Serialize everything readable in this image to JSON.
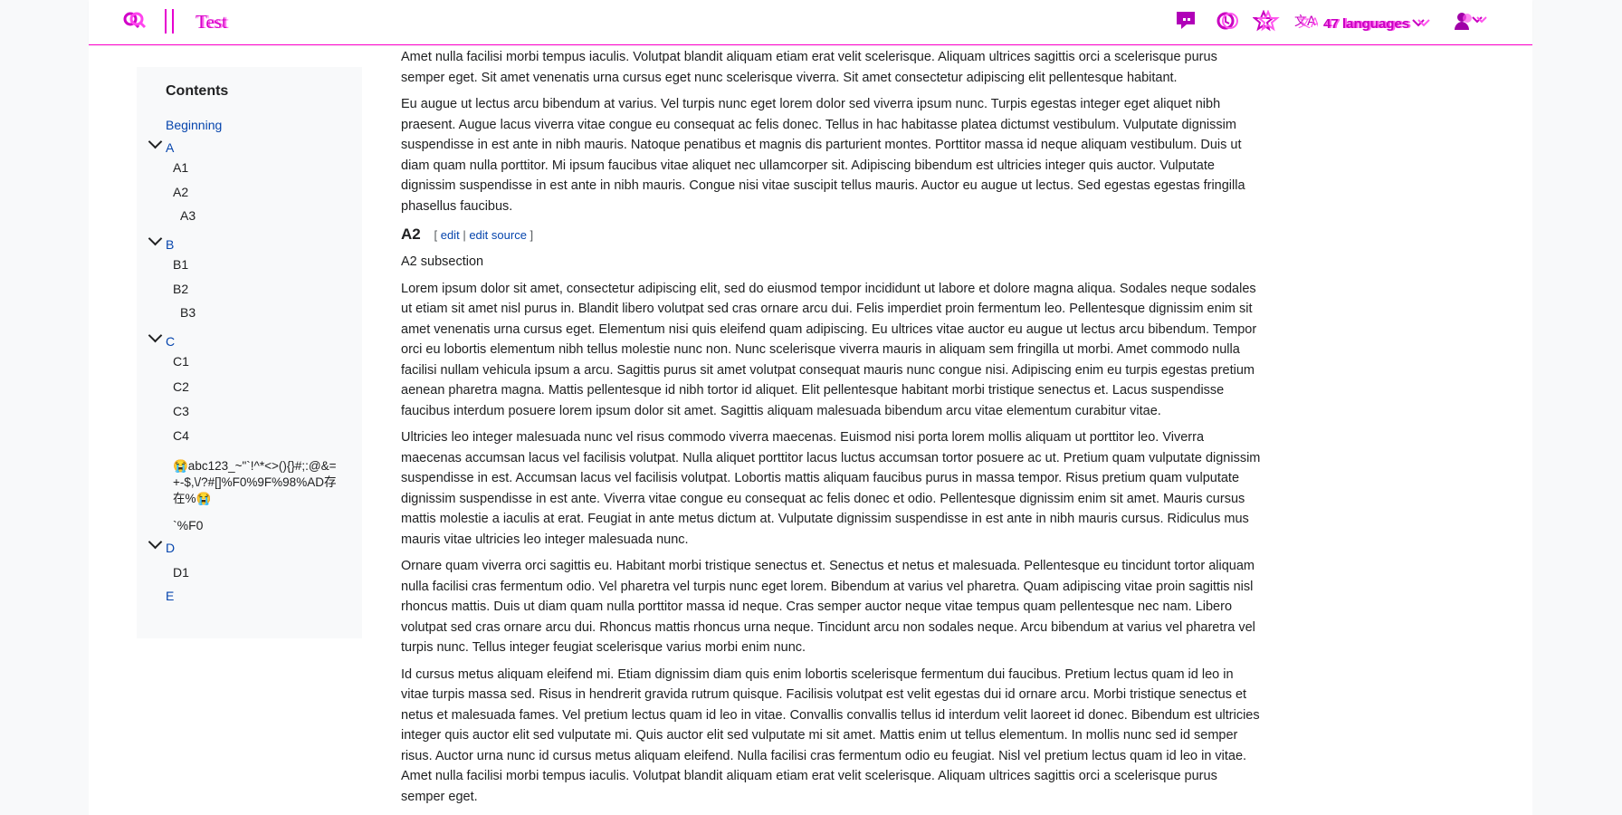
{
  "header": {
    "search_icon": "search-icon",
    "title": "Test",
    "languages_label": "47 languages",
    "icons": [
      "talk-icon",
      "history-icon",
      "watch-star-icon",
      "language-icon",
      "user-icon"
    ]
  },
  "toc": {
    "heading": "Contents",
    "items": [
      {
        "label": "Beginning"
      },
      {
        "label": "A"
      },
      {
        "label": "A1"
      },
      {
        "label": "A2"
      },
      {
        "label": "A3"
      },
      {
        "label": "B"
      },
      {
        "label": "B1"
      },
      {
        "label": "B2"
      },
      {
        "label": "B3"
      },
      {
        "label": "C"
      },
      {
        "label": "C1"
      },
      {
        "label": "C2"
      },
      {
        "label": "C3"
      },
      {
        "label": "C4"
      },
      {
        "label": "😭abc123_~\"`!^*<>(){}#;:@&=+-$,\\/?#[]%F0%9F%98%AD存在%😭"
      },
      {
        "label": "`%F0"
      },
      {
        "label": "D"
      },
      {
        "label": "D1"
      },
      {
        "label": "E"
      }
    ]
  },
  "article": {
    "p0": "turpis massa sed. Risus in hendrerit gravida rutrum quisque. Facilisis volutpat est velit egestas dui id ornare arcu. Morbi tristique senectus et netus et malesuada fames. Vel pretium lectus quam id leo in vitae. Convallis convallis tellus id interdum velit laoreet id donec. Bibendum est ultricies integer quis auctor elit sed vulputate mi. Quis auctor elit sed vulputate mi sit amet. Mattis enim ut tellus elementum. In mollis nunc sed id semper risus. Auctor urna nunc id cursus metus aliquam eleifend. Nulla facilisi cras fermentum odio eu feugiat. Nisl vel pretium lectus quam id leo in vitae. Amet nulla facilisi morbi tempus iaculis. Volutpat blandit aliquam etiam erat velit scelerisque. Aliquam ultrices sagittis orci a scelerisque purus semper eget. Sit amet venenatis urna cursus eget nunc scelerisque viverra. Sit amet consectetur adipiscing elit pellentesque habitant.",
    "p1": "Eu augue ut lectus arcu bibendum at varius. Vel turpis nunc eget lorem dolor sed viverra ipsum nunc. Turpis egestas integer eget aliquet nibh praesent. Augue lacus viverra vitae congue eu consequat ac felis donec. Tellus in hac habitasse platea dictumst vestibulum. Vulputate dignissim suspendisse in est ante in nibh mauris. Natoque penatibus et magnis dis parturient montes. Porttitor massa id neque aliquam vestibulum. Duis ut diam quam nulla porttitor. Mi ipsum faucibus vitae aliquet nec ullamcorper sit. Adipiscing bibendum est ultricies integer quis auctor. Vulputate dignissim suspendisse in est ante in nibh mauris. Congue nisi vitae suscipit tellus mauris. Auctor eu augue ut lectus. Sed egestas egestas fringilla phasellus faucibus.",
    "h_a2": "A2",
    "edit_open": "[",
    "edit": "edit",
    "edit_sep": "|",
    "edit_source": "edit source",
    "edit_close": "]",
    "a2_sub": "A2 subsection",
    "p2": "Lorem ipsum dolor sit amet, consectetur adipiscing elit, sed do eiusmod tempor incididunt ut labore et dolore magna aliqua. Sodales neque sodales ut etiam sit amet nisl purus in. Blandit libero volutpat sed cras ornare arcu dui. Felis imperdiet proin fermentum leo. Pellentesque dignissim enim sit amet venenatis urna cursus eget. Elementum nisi quis eleifend quam adipiscing. Eu ultrices vitae auctor eu augue ut lectus arcu bibendum. Tempor orci eu lobortis elementum nibh tellus molestie nunc non. Nunc scelerisque viverra mauris in aliquam sem fringilla ut morbi. Amet commodo nulla facilisi nullam vehicula ipsum a arcu. Sagittis purus sit amet volutpat consequat mauris nunc congue nisi. Adipiscing enim eu turpis egestas pretium aenean pharetra magna. Mattis pellentesque id nibh tortor id aliquet. Elit pellentesque habitant morbi tristique senectus et. Lacus suspendisse faucibus interdum posuere lorem ipsum dolor sit amet. Sagittis aliquam malesuada bibendum arcu vitae elementum curabitur vitae.",
    "p3": "Ultricies leo integer malesuada nunc vel risus commodo viverra maecenas. Euismod nisi porta lorem mollis aliquam ut porttitor leo. Viverra maecenas accumsan lacus vel facilisis volutpat. Nulla aliquet porttitor lacus luctus accumsan tortor posuere ac ut. Pretium quam vulputate dignissim suspendisse in est. Accumsan lacus vel facilisis volutpat. Lobortis mattis aliquam faucibus purus in massa tempor. Risus pretium quam vulputate dignissim suspendisse in est ante. Viverra vitae congue eu consequat ac felis donec et odio. Pellentesque dignissim enim sit amet. Mauris cursus mattis molestie a iaculis at erat. Feugiat in ante metus dictum at. Vulputate dignissim suspendisse in est ante in nibh mauris cursus. Ridiculus mus mauris vitae ultricies leo integer malesuada nunc.",
    "p4": "Ornare quam viverra orci sagittis eu. Habitant morbi tristique senectus et. Senectus et netus et malesuada. Pellentesque eu tincidunt tortor aliquam nulla facilisi cras fermentum odio. Vel pharetra vel turpis nunc eget lorem. Bibendum at varius vel pharetra. Quam adipiscing vitae proin sagittis nisl rhoncus mattis. Duis ut diam quam nulla porttitor massa id neque. Cras semper auctor neque vitae tempus quam pellentesque nec nam. Libero volutpat sed cras ornare arcu dui. Rhoncus mattis rhoncus urna neque. Tincidunt arcu non sodales neque. Arcu bibendum at varius vel pharetra vel turpis nunc. Tellus integer feugiat scelerisque varius morbi enim nunc.",
    "p5": "Id cursus metus aliquam eleifend mi. Etiam dignissim diam quis enim lobortis scelerisque fermentum dui faucibus. Pretium lectus quam id leo in vitae turpis massa sed. Risus in hendrerit gravida rutrum quisque. Facilisis volutpat est velit egestas dui id ornare arcu. Morbi tristique senectus et netus et malesuada fames. Vel pretium lectus quam id leo in vitae. Convallis convallis tellus id interdum velit laoreet id donec. Bibendum est ultricies integer quis auctor elit sed vulputate mi. Quis auctor elit sed vulputate mi sit amet. Mattis enim ut tellus elementum. In mollis nunc sed id semper risus. Auctor urna nunc id cursus metus aliquam eleifend. Nulla facilisi cras fermentum odio eu feugiat. Nisl vel pretium lectus quam id leo in vitae. Amet nulla facilisi morbi tempus iaculis. Volutpat blandit aliquam etiam erat velit scelerisque. Aliquam ultrices sagittis orci a scelerisque purus semper eget."
  }
}
